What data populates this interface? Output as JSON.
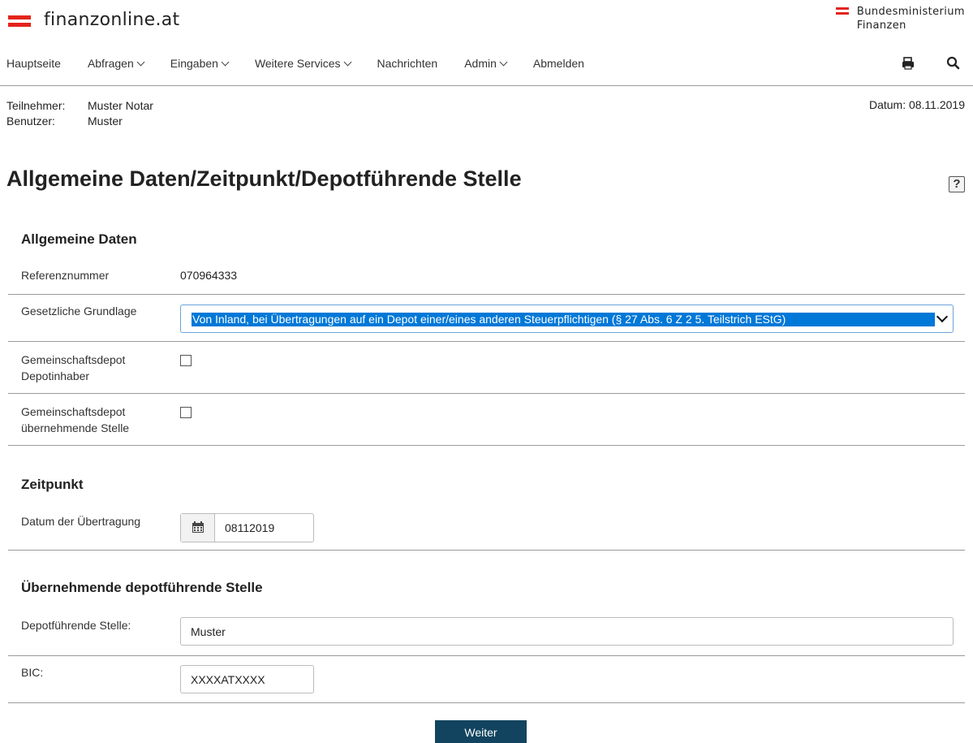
{
  "header": {
    "logo_text": "finanzonline.at",
    "ministry_line1": "Bundesministerium",
    "ministry_line2": "Finanzen",
    "brand_red": "#e3241b"
  },
  "nav": {
    "items": [
      {
        "label": "Hauptseite",
        "dropdown": false
      },
      {
        "label": "Abfragen",
        "dropdown": true
      },
      {
        "label": "Eingaben",
        "dropdown": true
      },
      {
        "label": "Weitere Services",
        "dropdown": true
      },
      {
        "label": "Nachrichten",
        "dropdown": false
      },
      {
        "label": "Admin",
        "dropdown": true
      },
      {
        "label": "Abmelden",
        "dropdown": false
      }
    ],
    "icons": [
      "print-icon",
      "search-icon"
    ]
  },
  "user": {
    "teilnehmer_label": "Teilnehmer:",
    "teilnehmer_value": "Muster Notar",
    "benutzer_label": "Benutzer:",
    "benutzer_value": "Muster",
    "datum": "Datum: 08.11.2019"
  },
  "page": {
    "title": "Allgemeine Daten/Zeitpunkt/Depotführende Stelle",
    "help": "?"
  },
  "allgemeine": {
    "title": "Allgemeine Daten",
    "referenz_label": "Referenznummer",
    "referenz_value": "070964333",
    "grundlage_label": "Gesetzliche Grundlage",
    "grundlage_value": "Von Inland, bei Übertragungen auf ein Depot einer/eines anderen Steuerpflichtigen (§ 27 Abs. 6 Z 2 5. Teilstrich EStG)",
    "gem_inhaber_label_1": "Gemeinschaftsdepot",
    "gem_inhaber_label_2": "Depotinhaber",
    "gem_inhaber_checked": false,
    "gem_stelle_label_1": "Gemeinschaftsdepot",
    "gem_stelle_label_2": "übernehmende Stelle",
    "gem_stelle_checked": false
  },
  "zeitpunkt": {
    "title": "Zeitpunkt",
    "datum_label": "Datum der Übertragung",
    "datum_value": "08112019"
  },
  "stelle": {
    "title": "Übernehmende depotführende Stelle",
    "depot_label": "Depotführende Stelle:",
    "depot_value": "Muster",
    "bic_label": "BIC:",
    "bic_value": "XXXXATXXXX"
  },
  "actions": {
    "weiter_label": "Weiter",
    "button_color": "#12445f"
  }
}
